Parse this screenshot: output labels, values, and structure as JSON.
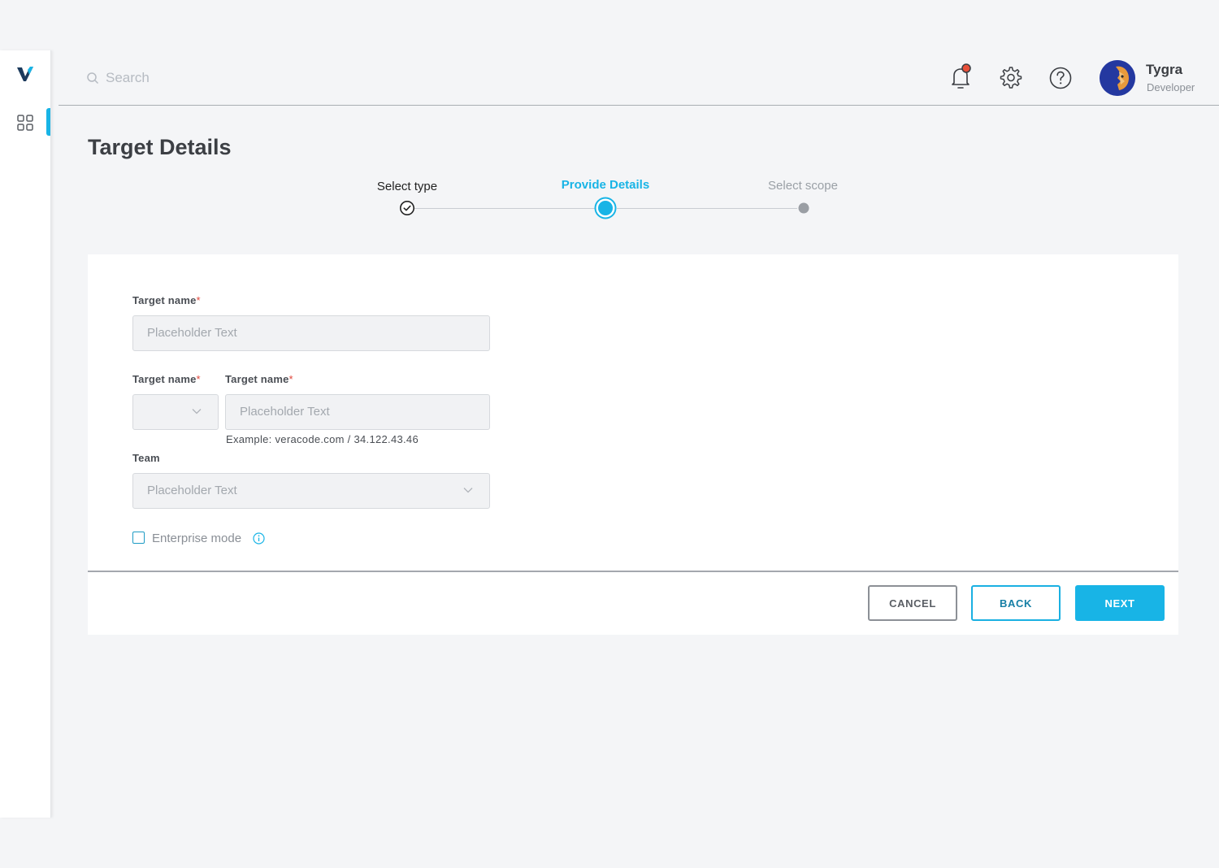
{
  "app": {
    "brand": "V"
  },
  "search": {
    "placeholder": "Search"
  },
  "user": {
    "name": "Tygra",
    "role": "Developer"
  },
  "page": {
    "title": "Target Details"
  },
  "stepper": {
    "steps": [
      {
        "label": "Select type",
        "state": "completed"
      },
      {
        "label": "Provide Details",
        "state": "active"
      },
      {
        "label": "Select scope",
        "state": "upcoming"
      }
    ]
  },
  "form": {
    "target_name_label": "Target name",
    "target_name_placeholder": "Placeholder Text",
    "protocol_label": "Target name",
    "host_label": "Target name",
    "host_placeholder": "Placeholder Text",
    "host_hint": "Example: veracode.com / 34.122.43.46",
    "team_label": "Team",
    "team_placeholder": "Placeholder Text",
    "required_marker": "*",
    "enterprise_mode_label": "Enterprise mode",
    "enterprise_mode_checked": false
  },
  "actions": {
    "cancel": "CANCEL",
    "back": "BACK",
    "next": "NEXT"
  },
  "colors": {
    "accent": "#18b4e6",
    "required": "#e0473c",
    "notification_dot": "#e8503a"
  }
}
